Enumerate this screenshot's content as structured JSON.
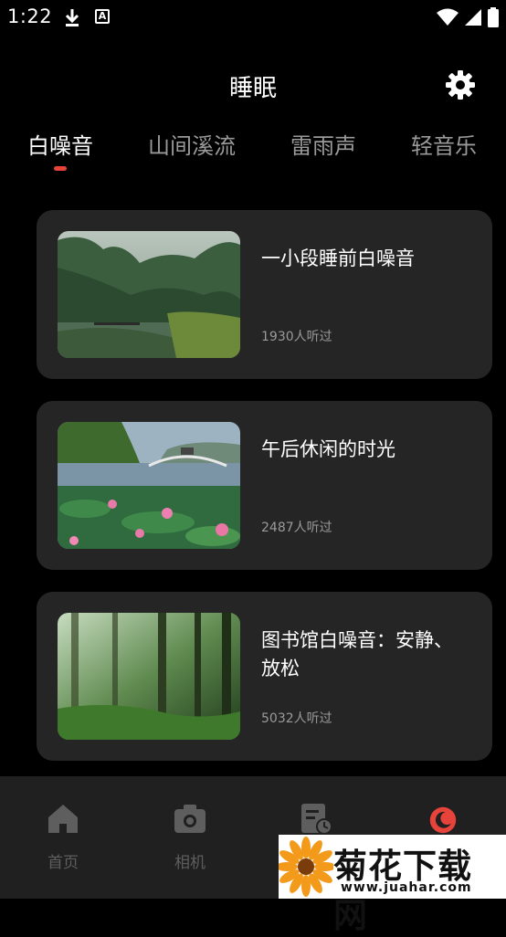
{
  "status_bar": {
    "time": "1:22",
    "download_icon": "download-icon",
    "text_icon_letter": "A"
  },
  "header": {
    "title": "睡眠",
    "settings_icon": "gear-icon"
  },
  "tabs": [
    {
      "label": "白噪音",
      "active": true
    },
    {
      "label": "山间溪流",
      "active": false
    },
    {
      "label": "雷雨声",
      "active": false
    },
    {
      "label": "轻音乐",
      "active": false
    }
  ],
  "cards": [
    {
      "title": "一小段睡前白噪音",
      "listeners": "1930人听过",
      "image": "rainy forest pond"
    },
    {
      "title": "午后休闲的时光",
      "listeners": "2487人听过",
      "image": "lotus lake with bridge"
    },
    {
      "title": "图书馆白噪音：安静、放松",
      "listeners": "5032人听过",
      "image": "sunlit forest"
    }
  ],
  "bottom_nav": [
    {
      "label": "首页",
      "icon": "home-icon",
      "active": false
    },
    {
      "label": "相机",
      "icon": "camera-icon",
      "active": false
    },
    {
      "label": "",
      "icon": "clipboard-clock-icon",
      "active": false
    },
    {
      "label": "",
      "icon": "sleep-icon",
      "active": true
    }
  ],
  "watermark": {
    "brand": "菊花下载网",
    "url": "www.juahar.com"
  },
  "colors": {
    "accent": "#e8433a",
    "card_bg": "#252525",
    "nav_bg": "#202020",
    "muted": "#9a9a9a"
  }
}
